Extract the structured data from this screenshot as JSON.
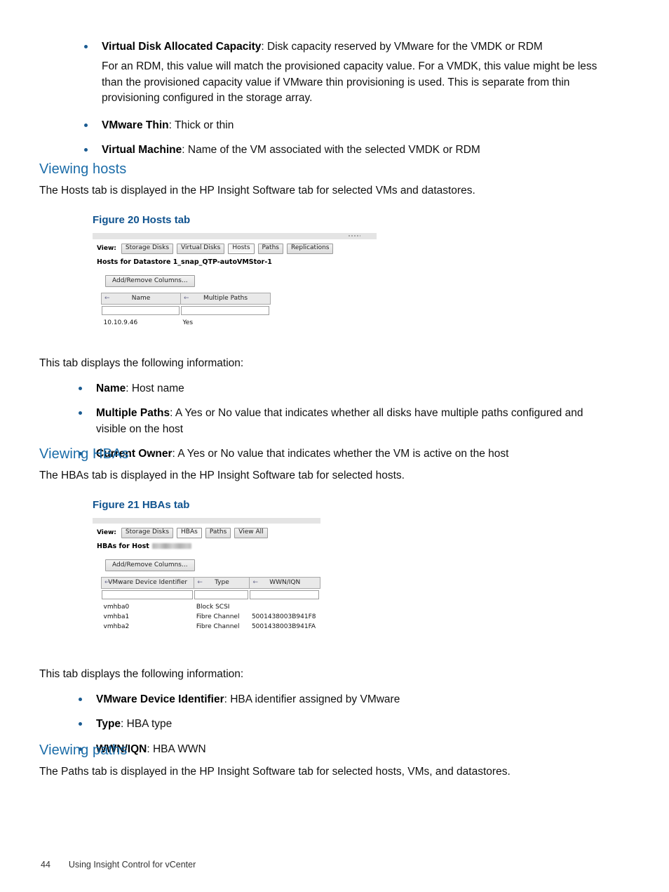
{
  "intro_bullets": [
    {
      "term": "Virtual Disk Allocated Capacity",
      "desc": ": Disk capacity reserved by VMware for the VMDK or RDM",
      "continuation": "For an RDM, this value will match the provisioned capacity value. For a VMDK, this value might be less than the provisioned capacity value if VMware thin provisioning is used. This is separate from thin provisioning configured in the storage array."
    },
    {
      "term": "VMware Thin",
      "desc": ": Thick or thin"
    },
    {
      "term": "Virtual Machine",
      "desc": ": Name of the VM associated with the selected VMDK or RDM"
    }
  ],
  "viewing_hosts": {
    "heading": "Viewing hosts",
    "intro": "The Hosts tab is displayed in the HP Insight Software tab for selected VMs and datastores.",
    "figure_caption": "Figure 20 Hosts tab",
    "figure": {
      "view_label": "View:",
      "tabs": [
        {
          "label": "Storage Disks",
          "selected": false
        },
        {
          "label": "Virtual Disks",
          "selected": false
        },
        {
          "label": "Hosts",
          "selected": true
        },
        {
          "label": "Paths",
          "selected": false
        },
        {
          "label": "Replications",
          "selected": false
        }
      ],
      "context_label": "Hosts for Datastore 1_snap_QTP-autoVMStor-1",
      "add_remove_label": "Add/Remove Columns...",
      "sort_arrow": "←",
      "columns": [
        "Name",
        "Multiple Paths"
      ],
      "rows": [
        [
          "10.10.9.46",
          "Yes"
        ]
      ]
    },
    "tab_intro": "This tab displays the following information:",
    "bullets": [
      {
        "term": "Name",
        "desc": ": Host name"
      },
      {
        "term": "Multiple Paths",
        "desc": ": A Yes or No value that indicates whether all disks have multiple paths configured and visible on the host"
      },
      {
        "term": "Current Owner",
        "desc": ": A Yes or No value that indicates whether the VM is active on the host"
      }
    ]
  },
  "viewing_hbas": {
    "heading": "Viewing HBAs",
    "intro": "The HBAs tab is displayed in the HP Insight Software tab for selected hosts.",
    "figure_caption": "Figure 21 HBAs tab",
    "figure": {
      "view_label": "View:",
      "tabs": [
        {
          "label": "Storage Disks",
          "selected": false
        },
        {
          "label": "HBAs",
          "selected": true
        },
        {
          "label": "Paths",
          "selected": false
        },
        {
          "label": "View All",
          "selected": false
        }
      ],
      "context_label": "HBAs for Host",
      "context_value_redacted": true,
      "add_remove_label": "Add/Remove Columns...",
      "sort_arrow": "←",
      "columns": [
        "VMware Device Identifier",
        "Type",
        "WWN/IQN"
      ],
      "rows": [
        [
          "vmhba0",
          "Block SCSI",
          ""
        ],
        [
          "vmhba1",
          "Fibre Channel",
          "5001438003B941F8"
        ],
        [
          "vmhba2",
          "Fibre Channel",
          "5001438003B941FA"
        ]
      ]
    },
    "tab_intro": "This tab displays the following information:",
    "bullets": [
      {
        "term": "VMware Device Identifier",
        "desc": ": HBA identifier assigned by VMware"
      },
      {
        "term": "Type",
        "desc": ": HBA type"
      },
      {
        "term": "WWN/IQN",
        "desc": ": HBA WWN"
      }
    ]
  },
  "viewing_paths": {
    "heading": "Viewing paths",
    "intro": "The Paths tab is displayed in the HP Insight Software tab for selected hosts, VMs, and datastores."
  },
  "footer": {
    "page_number": "44",
    "document_title": "Using Insight Control for vCenter"
  },
  "colors": {
    "heading_blue": "#1b6ca8",
    "figure_caption_blue": "#10538f",
    "bullet_blue": "#1a5b91"
  }
}
